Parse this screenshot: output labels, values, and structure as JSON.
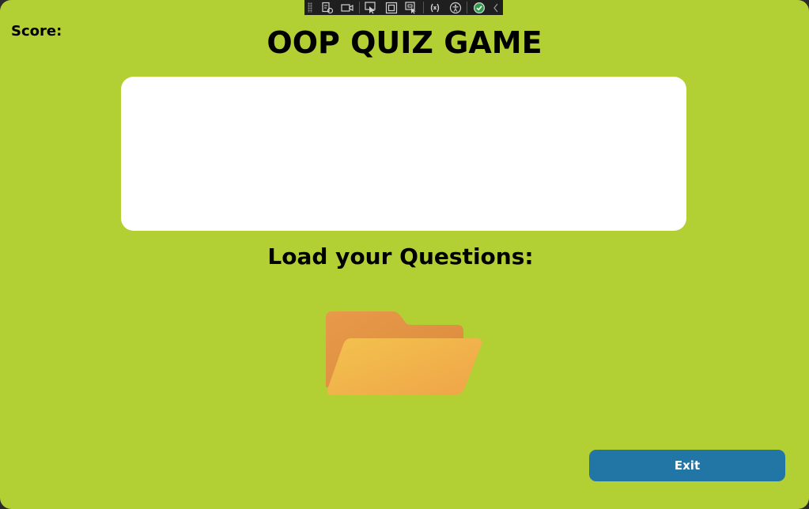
{
  "window": {
    "background_color": "#b2cf34"
  },
  "toolbar": {
    "icons": [
      "live-visual-tree-icon",
      "video-record-icon",
      "select-element-icon",
      "display-layout-adorners-icon",
      "track-focused-element-icon",
      "binding-failures-icon",
      "accessibility-checker-icon",
      "hot-reload-ok-icon",
      "collapse-chevron-icon"
    ]
  },
  "score": {
    "label": "Score:",
    "value": ""
  },
  "title": "OOP QUIZ GAME",
  "question_box": {
    "text": ""
  },
  "load": {
    "label": "Load your Questions:",
    "icon": "folder-open-icon"
  },
  "exit_button": {
    "label": "Exit",
    "color": "#2176a6"
  }
}
